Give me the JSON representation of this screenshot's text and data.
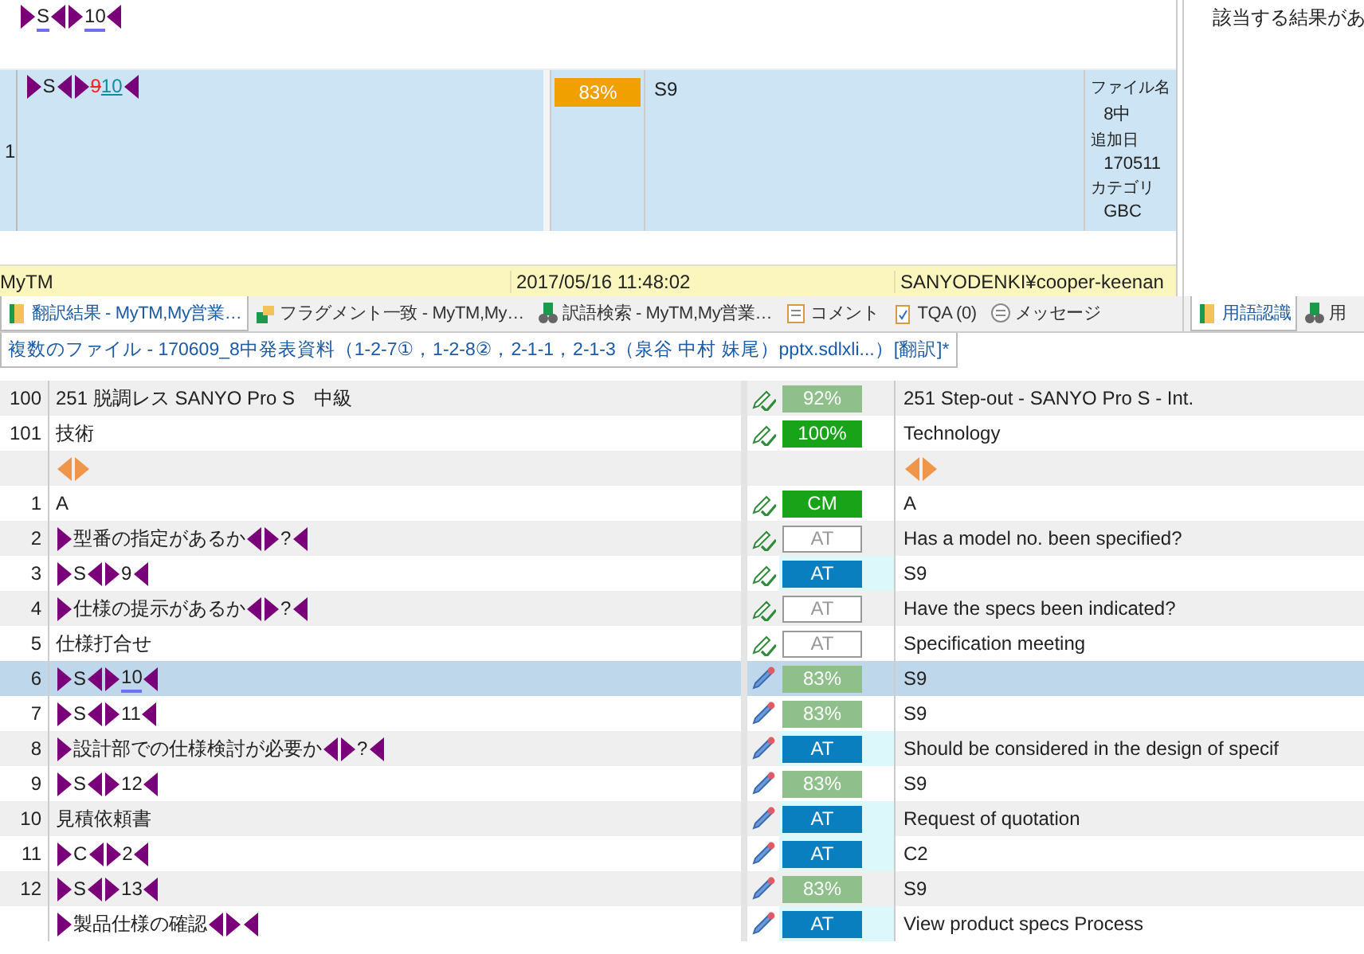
{
  "preview": {
    "parts": [
      {
        "kind": "tag_start"
      },
      {
        "kind": "text",
        "text": "S",
        "marked": true
      },
      {
        "kind": "tag_end"
      },
      {
        "kind": "tag_start"
      },
      {
        "kind": "text",
        "text": "10",
        "marked": true
      },
      {
        "kind": "tag_end"
      }
    ]
  },
  "result": {
    "number": "1",
    "source": [
      {
        "kind": "tag_start"
      },
      {
        "kind": "text",
        "text": "S"
      },
      {
        "kind": "tag_end"
      },
      {
        "kind": "tag_start"
      },
      {
        "kind": "deleted",
        "text": "9"
      },
      {
        "kind": "inserted",
        "text": "10"
      },
      {
        "kind": "tag_end"
      }
    ],
    "match": "83%",
    "target": "S9",
    "meta": [
      {
        "label": "ファイル名",
        "value": "8中"
      },
      {
        "label": "追加日",
        "value": "170511"
      },
      {
        "label": "カテゴリ",
        "value": "GBC"
      }
    ]
  },
  "status_bar": {
    "tm": "MyTM",
    "date": "2017/05/16 11:48:02",
    "user": "SANYODENKI¥cooper-keenan"
  },
  "side_panel": {
    "message": "該当する結果があ"
  },
  "tabs": [
    {
      "label": "翻訳結果 - MyTM,My営業…",
      "selected": true
    },
    {
      "label": "フラグメント一致 - MyTM,My…",
      "selected": false
    },
    {
      "label": "訳語検索 - MyTM,My営業…",
      "selected": false
    },
    {
      "label": "コメント",
      "selected": false
    },
    {
      "label": "TQA (0)",
      "selected": false
    },
    {
      "label": "メッセージ",
      "selected": false
    }
  ],
  "side_tabs": [
    {
      "label": "用語認識",
      "selected": true
    },
    {
      "label": "用",
      "selected": false
    }
  ],
  "document_tab": {
    "label": "複数のファイル - 170609_8中発表資料（1-2-7①，1-2-8②，2-1-1，2-1-3（泉谷 中村 妹尾）pptx.sdlxli...）[翻訳]*"
  },
  "rows": [
    {
      "number": "100",
      "source": [
        {
          "kind": "text",
          "text": "251 脱調レス SANYO Pro S　中級"
        }
      ],
      "confirmed": true,
      "match": {
        "text": "92%",
        "kind": "fuzzy"
      },
      "target": [
        {
          "kind": "text",
          "text": "251 Step-out - SANYO Pro S - Int."
        }
      ],
      "selected": false
    },
    {
      "number": "101",
      "source": [
        {
          "kind": "text",
          "text": "技術"
        }
      ],
      "confirmed": true,
      "match": {
        "text": "100%",
        "kind": "exact"
      },
      "target": [
        {
          "kind": "text",
          "text": "Technology"
        }
      ],
      "selected": false
    },
    {
      "source": [
        {
          "kind": "tag_end",
          "color": "#f0964a"
        },
        {
          "kind": "tag_start",
          "color": "#f0964a"
        }
      ],
      "target": [
        {
          "kind": "tag_end",
          "color": "#f0964a"
        },
        {
          "kind": "tag_start",
          "color": "#f0964a"
        }
      ],
      "selected": false
    },
    {
      "number": "1",
      "source": [
        {
          "kind": "text",
          "text": "A"
        }
      ],
      "confirmed": true,
      "match": {
        "text": "CM",
        "kind": "exact"
      },
      "target": [
        {
          "kind": "text",
          "text": "A"
        }
      ],
      "selected": false
    },
    {
      "number": "2",
      "source": [
        {
          "kind": "tag_start"
        },
        {
          "kind": "text",
          "text": "型番の指定があるか"
        },
        {
          "kind": "tag_end"
        },
        {
          "kind": "tag_start"
        },
        {
          "kind": "text",
          "text": "?"
        },
        {
          "kind": "tag_end"
        }
      ],
      "confirmed": true,
      "match": {
        "text": "AT",
        "kind": "draft"
      },
      "target": [
        {
          "kind": "text",
          "text": "Has a model no. been specified?"
        }
      ],
      "selected": false
    },
    {
      "number": "3",
      "source": [
        {
          "kind": "tag_start"
        },
        {
          "kind": "text",
          "text": "S"
        },
        {
          "kind": "tag_end"
        },
        {
          "kind": "tag_start"
        },
        {
          "kind": "text",
          "text": "9"
        },
        {
          "kind": "tag_end"
        }
      ],
      "confirmed": true,
      "match": {
        "text": "AT",
        "kind": "auto"
      },
      "target": [
        {
          "kind": "text",
          "text": "S9"
        }
      ],
      "selected": false
    },
    {
      "number": "4",
      "source": [
        {
          "kind": "tag_start"
        },
        {
          "kind": "text",
          "text": "仕様の提示があるか"
        },
        {
          "kind": "tag_end"
        },
        {
          "kind": "tag_start"
        },
        {
          "kind": "text",
          "text": "?"
        },
        {
          "kind": "tag_end"
        }
      ],
      "confirmed": true,
      "match": {
        "text": "AT",
        "kind": "draft"
      },
      "target": [
        {
          "kind": "text",
          "text": "Have the specs been indicated?"
        }
      ],
      "selected": false
    },
    {
      "number": "5",
      "source": [
        {
          "kind": "text",
          "text": "仕様打合せ"
        }
      ],
      "confirmed": true,
      "match": {
        "text": "AT",
        "kind": "draft"
      },
      "target": [
        {
          "kind": "text",
          "text": "Specification meeting"
        }
      ],
      "selected": false
    },
    {
      "number": "6",
      "source": [
        {
          "kind": "tag_start"
        },
        {
          "kind": "text",
          "text": "S"
        },
        {
          "kind": "tag_end"
        },
        {
          "kind": "tag_start"
        },
        {
          "kind": "text",
          "text": "10",
          "marked": true
        },
        {
          "kind": "tag_end"
        }
      ],
      "confirmed": false,
      "match": {
        "text": "83%",
        "kind": "fuzzy"
      },
      "target": [
        {
          "kind": "text",
          "text": "S9"
        }
      ],
      "selected": true
    },
    {
      "number": "7",
      "source": [
        {
          "kind": "tag_start"
        },
        {
          "kind": "text",
          "text": "S"
        },
        {
          "kind": "tag_end"
        },
        {
          "kind": "tag_start"
        },
        {
          "kind": "text",
          "text": "11"
        },
        {
          "kind": "tag_end"
        }
      ],
      "confirmed": false,
      "match": {
        "text": "83%",
        "kind": "fuzzy"
      },
      "target": [
        {
          "kind": "text",
          "text": "S9"
        }
      ],
      "selected": false
    },
    {
      "number": "8",
      "source": [
        {
          "kind": "tag_start"
        },
        {
          "kind": "text",
          "text": "設計部での仕様検討が必要か"
        },
        {
          "kind": "tag_end"
        },
        {
          "kind": "tag_start"
        },
        {
          "kind": "text",
          "text": "?"
        },
        {
          "kind": "tag_end"
        }
      ],
      "confirmed": false,
      "match": {
        "text": "AT",
        "kind": "auto"
      },
      "target": [
        {
          "kind": "text",
          "text": "Should be considered in the design of specif"
        }
      ],
      "selected": false
    },
    {
      "number": "9",
      "source": [
        {
          "kind": "tag_start"
        },
        {
          "kind": "text",
          "text": "S"
        },
        {
          "kind": "tag_end"
        },
        {
          "kind": "tag_start"
        },
        {
          "kind": "text",
          "text": "12"
        },
        {
          "kind": "tag_end"
        }
      ],
      "confirmed": false,
      "match": {
        "text": "83%",
        "kind": "fuzzy"
      },
      "target": [
        {
          "kind": "text",
          "text": "S9"
        }
      ],
      "selected": false
    },
    {
      "number": "10",
      "source": [
        {
          "kind": "text",
          "text": "見積依頼書"
        }
      ],
      "confirmed": false,
      "match": {
        "text": "AT",
        "kind": "auto"
      },
      "target": [
        {
          "kind": "text",
          "text": "Request of quotation"
        }
      ],
      "selected": false
    },
    {
      "number": "11",
      "source": [
        {
          "kind": "tag_start"
        },
        {
          "kind": "text",
          "text": "C"
        },
        {
          "kind": "tag_end"
        },
        {
          "kind": "tag_start"
        },
        {
          "kind": "text",
          "text": "2"
        },
        {
          "kind": "tag_end"
        }
      ],
      "confirmed": false,
      "match": {
        "text": "AT",
        "kind": "auto"
      },
      "target": [
        {
          "kind": "text",
          "text": "C2"
        }
      ],
      "selected": false
    },
    {
      "number": "12",
      "source": [
        {
          "kind": "tag_start"
        },
        {
          "kind": "text",
          "text": "S"
        },
        {
          "kind": "tag_end"
        },
        {
          "kind": "tag_start"
        },
        {
          "kind": "text",
          "text": "13"
        },
        {
          "kind": "tag_end"
        }
      ],
      "confirmed": false,
      "match": {
        "text": "83%",
        "kind": "fuzzy"
      },
      "target": [
        {
          "kind": "text",
          "text": "S9"
        }
      ],
      "selected": false
    },
    {
      "source": [
        {
          "kind": "tag_start"
        },
        {
          "kind": "text",
          "text": "製品仕様の確認"
        },
        {
          "kind": "tag_end"
        },
        {
          "kind": "tag_start"
        },
        {
          "kind": "tag_end"
        }
      ],
      "confirmed": false,
      "match": {
        "text": "AT",
        "kind": "auto"
      },
      "target": [
        {
          "kind": "text",
          "text": "View product specs Process"
        }
      ],
      "selected": false
    }
  ]
}
